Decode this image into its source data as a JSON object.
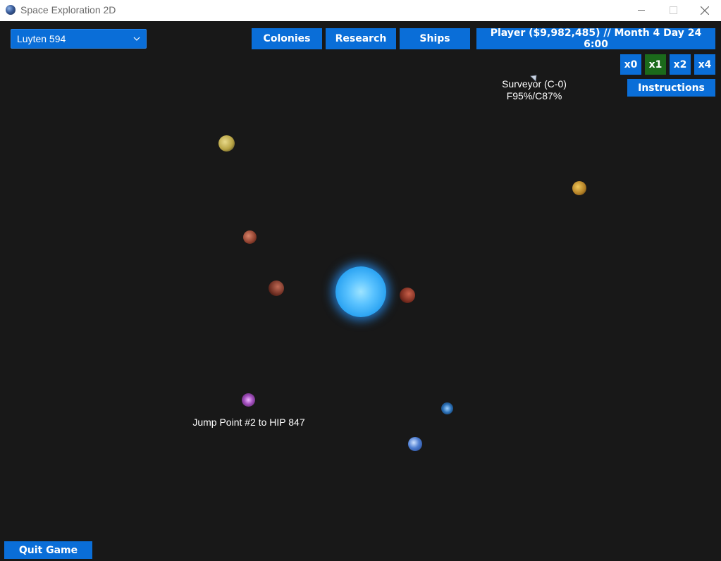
{
  "window": {
    "title": "Space Exploration 2D",
    "icon": "planet-icon"
  },
  "system_selector": {
    "selected": "Luyten 594"
  },
  "top_bar": {
    "colonies_label": "Colonies",
    "research_label": "Research",
    "ships_label": "Ships",
    "player_status": "Player ($9,982,485) // Month 4 Day 24 6:00"
  },
  "speed_controls": {
    "options": [
      "x0",
      "x1",
      "x2",
      "x4"
    ],
    "active": "x1",
    "active_color": "#1b6a1b"
  },
  "instructions_label": "Instructions",
  "quit_label": "Quit Game",
  "map": {
    "ship": {
      "name": "Surveyor (C-0)",
      "status": "F95%/C87%"
    },
    "jump_point_label": "Jump Point #2 to HIP 847"
  },
  "colors": {
    "button_blue": "#0a6ed8",
    "background": "#181818",
    "star": "#5bc3ff"
  }
}
